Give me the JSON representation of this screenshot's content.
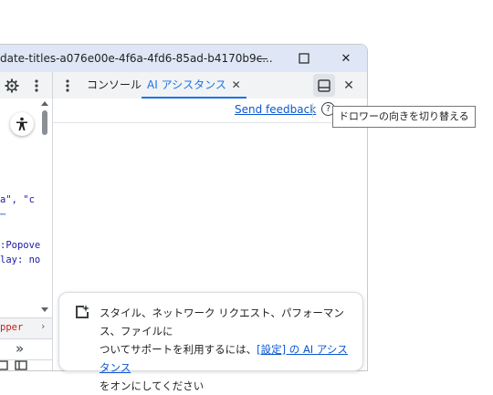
{
  "window": {
    "title": "date-titles-a076e00e-4f6a-4fd6-85ad-b4170b9c...",
    "minimize": "—",
    "maximize": "☐",
    "close": "✕"
  },
  "toolbar": {
    "tabs": [
      {
        "label": "コンソール"
      },
      {
        "label": "AI アシスタンス",
        "close": "✕"
      }
    ],
    "panel_close": "✕"
  },
  "feedback": {
    "label": "Send feedback",
    "help": "?"
  },
  "tooltip": {
    "text": "ドロワーの向きを切り替える"
  },
  "left_code": {
    "line1": "a\", \"c",
    "line2": "⋯",
    "line3": ":Popove",
    "line4": "lay: no",
    "line5": "pper",
    "arrow": "›",
    "chevrons": "»"
  },
  "notice": {
    "line1": "スタイル、ネットワーク リクエスト、パフォーマンス、ファイルに",
    "line2_prefix": "ついてサポートを利用するには、",
    "line2_link": "[設定] の AI アシスタンス",
    "line3": "をオンにしてください"
  },
  "colors": {
    "accent": "#1a73e8",
    "titlebar": "#dfe7f6",
    "toolbar": "#f1f3f4"
  }
}
